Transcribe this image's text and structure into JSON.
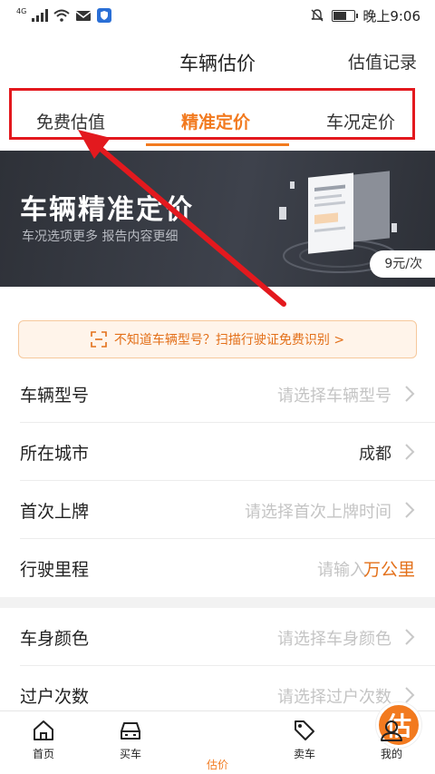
{
  "status_bar": {
    "network": "4G",
    "time": "晚上9:06"
  },
  "header": {
    "title": "车辆估价",
    "action": "估值记录"
  },
  "tabs": [
    {
      "label": "免费估值",
      "active": false
    },
    {
      "label": "精准定价",
      "active": true
    },
    {
      "label": "车况定价",
      "active": false
    }
  ],
  "banner": {
    "title": "车辆精准定价",
    "subtitle": "车况选项更多 报告内容更细",
    "price": "9元/次"
  },
  "scan_tip": {
    "text": "不知道车辆型号？扫描行驶证免费识别 >"
  },
  "form": {
    "rows": [
      {
        "label": "车辆型号",
        "value": "请选择车辆型号",
        "filled": false
      },
      {
        "label": "所在城市",
        "value": "成都",
        "filled": true
      },
      {
        "label": "首次上牌",
        "value": "请选择首次上牌时间",
        "filled": false
      },
      {
        "label": "行驶里程",
        "placeholder": "请输入",
        "unit": "万公里"
      }
    ],
    "rows2": [
      {
        "label": "车身颜色",
        "value": "请选择车身颜色",
        "filled": false
      },
      {
        "label": "过户次数",
        "value": "请选择过户次数",
        "filled": false
      }
    ]
  },
  "bottom_nav": {
    "items": [
      {
        "label": "首页",
        "icon": "home-icon"
      },
      {
        "label": "买车",
        "icon": "car-icon"
      },
      {
        "label": "估价",
        "icon": "estimate-icon",
        "bubble": "估",
        "active": true
      },
      {
        "label": "卖车",
        "icon": "tag-icon"
      },
      {
        "label": "我的",
        "icon": "user-icon"
      }
    ]
  },
  "colors": {
    "accent": "#f27a1f",
    "highlight_box": "#e3191e",
    "banner_bg": "#34373e"
  }
}
